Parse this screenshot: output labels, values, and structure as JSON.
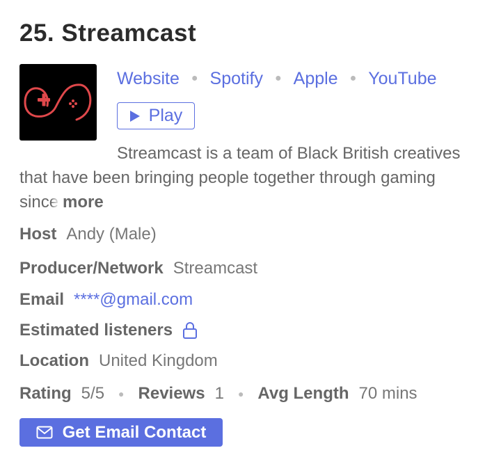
{
  "podcast": {
    "title": "25. Streamcast",
    "logo_icon": "gamepad-icon",
    "links": [
      "Website",
      "Spotify",
      "Apple",
      "YouTube"
    ],
    "play_label": "Play",
    "description_lead": "Streamcast is a team of Black British creatives that have been bringing people together through gaming sin",
    "description_faded": "ce",
    "more_label": "more"
  },
  "details": {
    "host_label": "Host",
    "host_value": "Andy (Male)",
    "producer_label": "Producer/Network",
    "producer_value": "Streamcast",
    "email_label": "Email",
    "email_value": "****@gmail.com",
    "listeners_label": "Estimated listeners",
    "listeners_icon": "lock-icon",
    "location_label": "Location",
    "location_value": "United Kingdom",
    "rating_label": "Rating",
    "rating_value": "5/5",
    "reviews_label": "Reviews",
    "reviews_value": "1",
    "length_label": "Avg Length",
    "length_value": "70 mins"
  },
  "cta": {
    "label": "Get Email Contact",
    "icon": "mail-icon"
  },
  "colors": {
    "accent": "#5b6fe0",
    "logo_bg": "#000000",
    "logo_line": "#e0484b"
  }
}
